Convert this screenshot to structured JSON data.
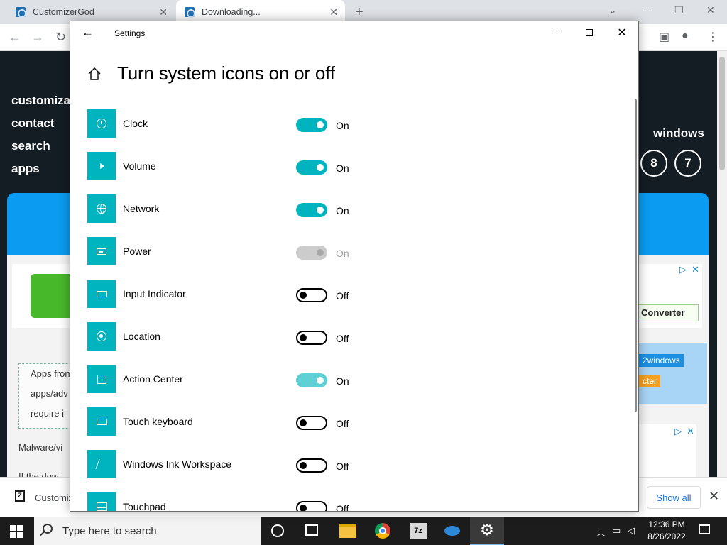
{
  "browser": {
    "tabs": [
      {
        "title": "CustomizerGod"
      },
      {
        "title": "Downloading..."
      }
    ],
    "window_controls": {
      "minimize": "—",
      "restore": "❐",
      "close": "✕"
    }
  },
  "webpage": {
    "nav": [
      "customizat",
      "contact",
      "search",
      "apps"
    ],
    "windows_label": "windows",
    "version_badges": [
      "8",
      "7"
    ],
    "converter_label": "Converter",
    "tag_2windows": "2windows",
    "tag_orange": "cter",
    "dashbox_lines": [
      "Apps fron",
      "apps/adv",
      "require i"
    ],
    "malware_text": "Malware/vi",
    "if_text": "If the dow"
  },
  "download_bar": {
    "item_name": "Customiz",
    "show_all": "Show all"
  },
  "taskbar": {
    "search_placeholder": "Type here to search",
    "time": "12:36 PM",
    "date": "8/26/2022",
    "sevenzip_label": "7z"
  },
  "settings": {
    "window_title": "Settings",
    "page_title": "Turn system icons on or off",
    "accent_color": "#00b4bf",
    "items": [
      {
        "label": "Clock",
        "state": "On",
        "icon": "clock-icon"
      },
      {
        "label": "Volume",
        "state": "On",
        "icon": "volume-icon"
      },
      {
        "label": "Network",
        "state": "On",
        "icon": "network-icon"
      },
      {
        "label": "Power",
        "state": "On",
        "icon": "battery-icon",
        "disabled": true
      },
      {
        "label": "Input Indicator",
        "state": "Off",
        "icon": "keyboard-icon"
      },
      {
        "label": "Location",
        "state": "Off",
        "icon": "location-icon"
      },
      {
        "label": "Action Center",
        "state": "On",
        "icon": "action-center-icon"
      },
      {
        "label": "Touch keyboard",
        "state": "Off",
        "icon": "touch-keyboard-icon"
      },
      {
        "label": "Windows Ink Workspace",
        "state": "Off",
        "icon": "pen-icon"
      },
      {
        "label": "Touchpad",
        "state": "Off",
        "icon": "touchpad-icon"
      }
    ]
  }
}
